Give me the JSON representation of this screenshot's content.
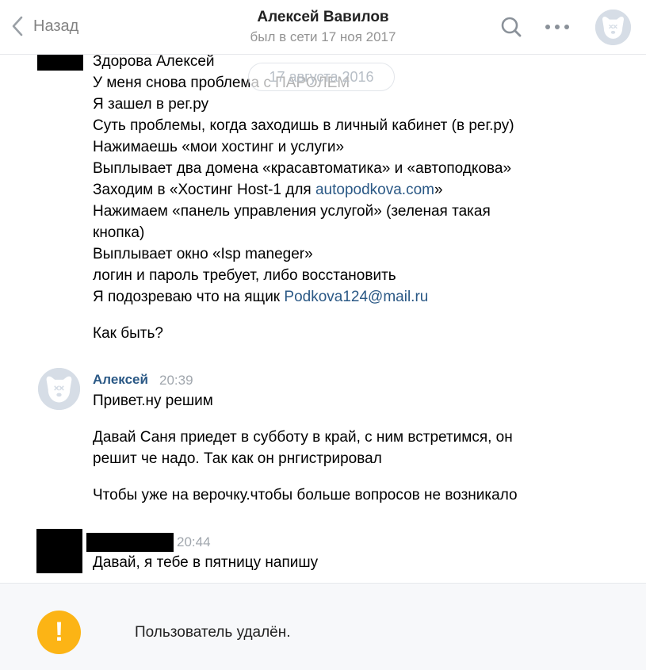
{
  "header": {
    "back_label": "Назад",
    "title": "Алексей Вавилов",
    "subtitle": "был в сети 17 ноя 2017"
  },
  "date_pill": "17 августа 2016",
  "messages": [
    {
      "lines": [
        "Здорова Алексей",
        "У меня снова проблема с ПАРОЛЕМ",
        "Я зашел в рег.ру",
        "Суть проблемы, когда заходишь в личный кабинет (в рег.ру)",
        "Нажимаешь «мои хостинг и услуги»",
        "Выплывает два домена «красавтоматика» и «автоподкова»",
        "Заходим в «Хостинг Host-1 для ",
        "autopodkova.com",
        "»",
        "Нажимаем «панель управления услугой» (зеленая такая",
        "кнопка)",
        "Выплывает окно «Isp maneger»",
        "логин и пароль требует, либо восстановить",
        "Я подозреваю что на ящик ",
        "Podkova124@mail.ru",
        "Как быть?"
      ]
    },
    {
      "author": "Алексей",
      "time": "20:39",
      "lines": [
        "Привет.ну решим",
        "Давай Саня приедет в субботу в край, с ним встретимся, он",
        "решит че надо. Так как он рнгистрировал",
        "Чтобы уже на верочку.чтобы больше вопросов не возникало"
      ]
    },
    {
      "time": "20:44",
      "lines": [
        "Давай, я тебе в пятницу напишу"
      ]
    }
  ],
  "footer": {
    "notice": "Пользователь удалён.",
    "icon_symbol": "!"
  },
  "colors": {
    "link": "#2a5885",
    "warning": "#fcb415",
    "muted": "#939393"
  }
}
